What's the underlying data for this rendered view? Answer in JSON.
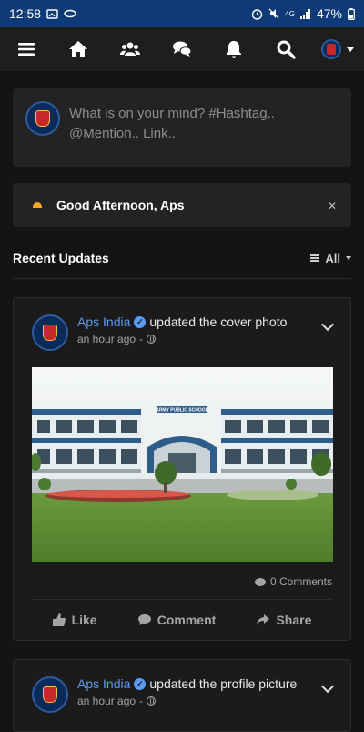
{
  "status_bar": {
    "time": "12:58",
    "battery": "47%",
    "network": "4G"
  },
  "nav": {
    "items": [
      "menu-icon",
      "home-icon",
      "friends-icon",
      "messages-icon",
      "notifications-icon",
      "search-icon",
      "profile-avatar"
    ]
  },
  "composer": {
    "placeholder": "What is on your mind? #Hashtag.. @Mention.. Link.."
  },
  "greeting": {
    "text": "Good Afternoon, Aps"
  },
  "recent": {
    "title": "Recent Updates",
    "filter_label": "All"
  },
  "posts": [
    {
      "author": "Aps India",
      "action": "updated the cover photo",
      "time": "an hour ago",
      "comments": "0 Comments",
      "building_sign": "ARMY PUBLIC SCHOOL",
      "actions": {
        "like": "Like",
        "comment": "Comment",
        "share": "Share"
      }
    },
    {
      "author": "Aps India",
      "action": "updated the profile picture",
      "time": "an hour ago"
    }
  ],
  "colors": {
    "accent": "#5b9bef",
    "status_bar": "#0f3a78",
    "background": "#141414",
    "card": "#1b1b1b"
  }
}
